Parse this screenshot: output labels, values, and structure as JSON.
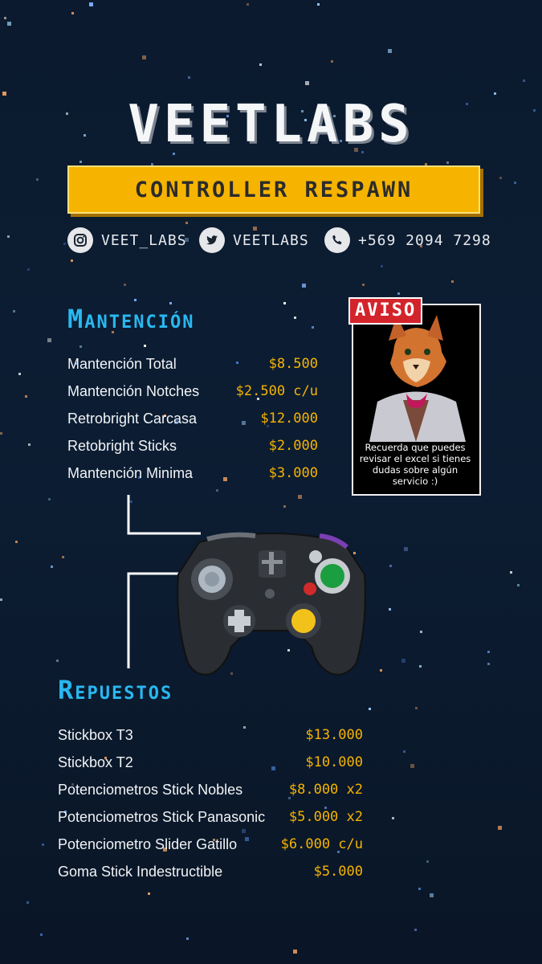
{
  "brand": {
    "name": "VEETLABS",
    "tagline": "CONTROLLER RESPAWN"
  },
  "social": [
    {
      "icon": "instagram-icon",
      "label": "VEET_LABS"
    },
    {
      "icon": "twitter-icon",
      "label": "VEETLABS"
    },
    {
      "icon": "phone-icon",
      "label": "+569 2094 7298"
    }
  ],
  "mantencion": {
    "title": "Mantención",
    "items": [
      {
        "name": "Mantención Total",
        "price": "$8.500"
      },
      {
        "name": "Mantención Notches",
        "price": "$2.500 c/u"
      },
      {
        "name": "Retrobright Carcasa",
        "price": "$12.000"
      },
      {
        "name": "Retobright Sticks",
        "price": "$2.000"
      },
      {
        "name": "Mantención Minima",
        "price": "$3.000"
      }
    ]
  },
  "aviso": {
    "tag": "AVISO",
    "text": "Recuerda que puedes revisar el excel si tienes dudas sobre algún servicio :)"
  },
  "repuestos": {
    "title": "Repuestos",
    "items": [
      {
        "name": "Stickbox T3",
        "price": "$13.000"
      },
      {
        "name": "Stickbox T2",
        "price": "$10.000"
      },
      {
        "name": "Potenciometros Stick Nobles",
        "price": "$8.000 x2"
      },
      {
        "name": "Potenciometros Stick Panasonic",
        "price": "$5.000 x2"
      },
      {
        "name": "Potenciometro Slider Gatillo",
        "price": "$6.000 c/u"
      },
      {
        "name": "Goma Stick Indestructible",
        "price": "$5.000"
      }
    ]
  },
  "colors": {
    "background": "#0b1a2e",
    "accent_yellow": "#f6b400",
    "title_blue": "#29b8f0",
    "aviso_red": "#d3242c"
  }
}
